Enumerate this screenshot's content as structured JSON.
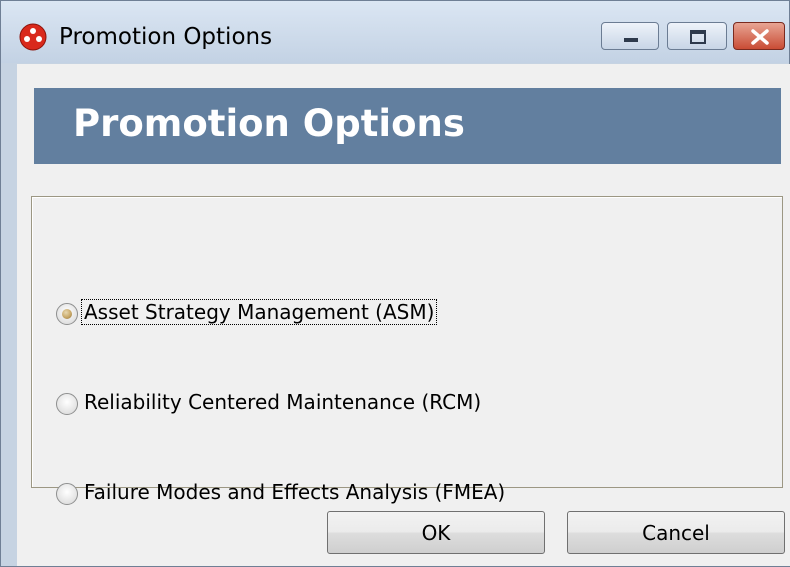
{
  "window": {
    "title": "Promotion Options",
    "app_icon": "app-logo-icon",
    "controls": {
      "minimize_icon": "minimize-icon",
      "maximize_icon": "maximize-icon",
      "close_icon": "close-icon"
    }
  },
  "banner": {
    "title": "Promotion Options",
    "color": "#627f9f"
  },
  "options": [
    {
      "label": "Asset Strategy Management (ASM)",
      "selected": true
    },
    {
      "label": "Reliability Centered Maintenance (RCM)",
      "selected": false
    },
    {
      "label": "Failure Modes and Effects Analysis (FMEA)",
      "selected": false
    }
  ],
  "buttons": {
    "ok": "OK",
    "cancel": "Cancel"
  }
}
